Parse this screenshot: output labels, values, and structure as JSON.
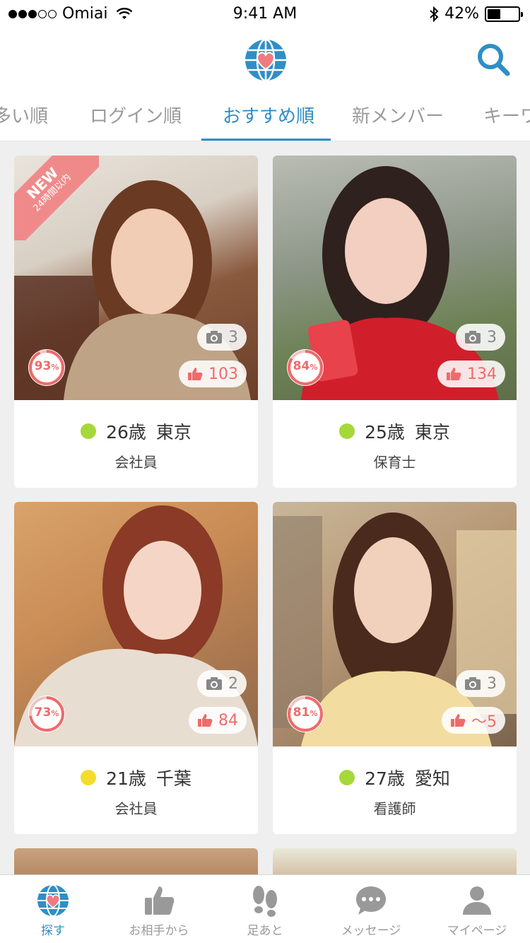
{
  "status_bar": {
    "carrier": "Omiai",
    "time": "9:41 AM",
    "battery": "42%",
    "battery_level": 0.42,
    "signal_bars_filled": 3,
    "signal_bars_total": 5
  },
  "header": {
    "logo_icon": "globe-heart-icon",
    "search_icon": "search-icon"
  },
  "tabs": [
    {
      "label": "多い順",
      "active": false
    },
    {
      "label": "ログイン順",
      "active": false
    },
    {
      "label": "おすすめ順",
      "active": true
    },
    {
      "label": "新メンバー",
      "active": false
    },
    {
      "label": "キーワ",
      "active": false
    }
  ],
  "colors": {
    "accent": "#2f8fc4",
    "like": "#ee6b6b",
    "online_green": "#a6d83a",
    "online_yellow": "#f3dc2c"
  },
  "ribbon": {
    "new_label": "NEW",
    "sub_label": "24時間以内"
  },
  "profiles": [
    {
      "match": "93",
      "match_unit": "%",
      "match_value": 0.93,
      "photos": "3",
      "likes": "103",
      "age": "26歳",
      "location": "東京",
      "job": "会社員",
      "status": "green",
      "new": true
    },
    {
      "match": "84",
      "match_unit": "%",
      "match_value": 0.84,
      "photos": "3",
      "likes": "134",
      "age": "25歳",
      "location": "東京",
      "job": "保育士",
      "status": "green",
      "new": false
    },
    {
      "match": "73",
      "match_unit": "%",
      "match_value": 0.73,
      "photos": "2",
      "likes": "84",
      "age": "21歳",
      "location": "千葉",
      "job": "会社員",
      "status": "yellow",
      "new": false
    },
    {
      "match": "81",
      "match_unit": "%",
      "match_value": 0.81,
      "photos": "3",
      "likes": "〜5",
      "age": "27歳",
      "location": "愛知",
      "job": "看護師",
      "status": "green",
      "new": false
    }
  ],
  "bottom_nav": [
    {
      "label": "探す",
      "icon": "globe-heart-icon",
      "active": true
    },
    {
      "label": "お相手から",
      "icon": "thumbs-up-icon",
      "active": false
    },
    {
      "label": "足あと",
      "icon": "footprints-icon",
      "active": false
    },
    {
      "label": "メッセージ",
      "icon": "chat-bubble-icon",
      "active": false
    },
    {
      "label": "マイページ",
      "icon": "person-icon",
      "active": false
    }
  ]
}
